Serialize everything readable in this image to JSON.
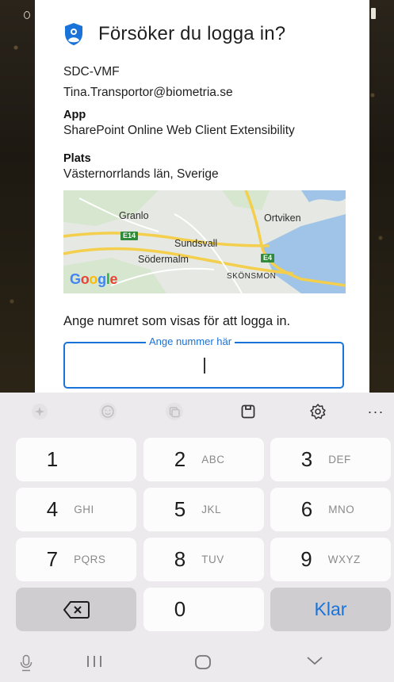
{
  "dialog": {
    "title": "Försöker du logga in?",
    "org": "SDC-VMF",
    "account": "Tina.Transportor@biometria.se",
    "app_label": "App",
    "app_value": "SharePoint Online Web Client Extensibility",
    "location_label": "Plats",
    "location_value": "Västernorrlands län, Sverige",
    "map": {
      "places": [
        "Granlo",
        "Ortviken",
        "Sundsvall",
        "Södermalm",
        "SKÖNSMON"
      ],
      "road_e14": "E14",
      "road_e4": "E4",
      "google_logo": "Google"
    },
    "prompt": "Ange numret som visas för att logga in.",
    "input": {
      "placeholder": "Ange nummer här",
      "value": ""
    }
  },
  "keyboard": {
    "toolbar_icons": [
      "sparkle-icon",
      "emoji-icon",
      "sticker-icon",
      "clipboard-icon",
      "settings-icon",
      "more-icon"
    ],
    "more_label": "···",
    "keys": [
      {
        "num": "1",
        "sub": ""
      },
      {
        "num": "2",
        "sub": "ABC"
      },
      {
        "num": "3",
        "sub": "DEF"
      },
      {
        "num": "4",
        "sub": "GHI"
      },
      {
        "num": "5",
        "sub": "JKL"
      },
      {
        "num": "6",
        "sub": "MNO"
      },
      {
        "num": "7",
        "sub": "PQRS"
      },
      {
        "num": "8",
        "sub": "TUV"
      },
      {
        "num": "9",
        "sub": "WXYZ"
      }
    ],
    "zero": "0",
    "done": "Klar"
  },
  "colors": {
    "accent": "#1a73d9",
    "keyboard_bg": "#eceaec",
    "key_bg": "#fcfcfc"
  }
}
